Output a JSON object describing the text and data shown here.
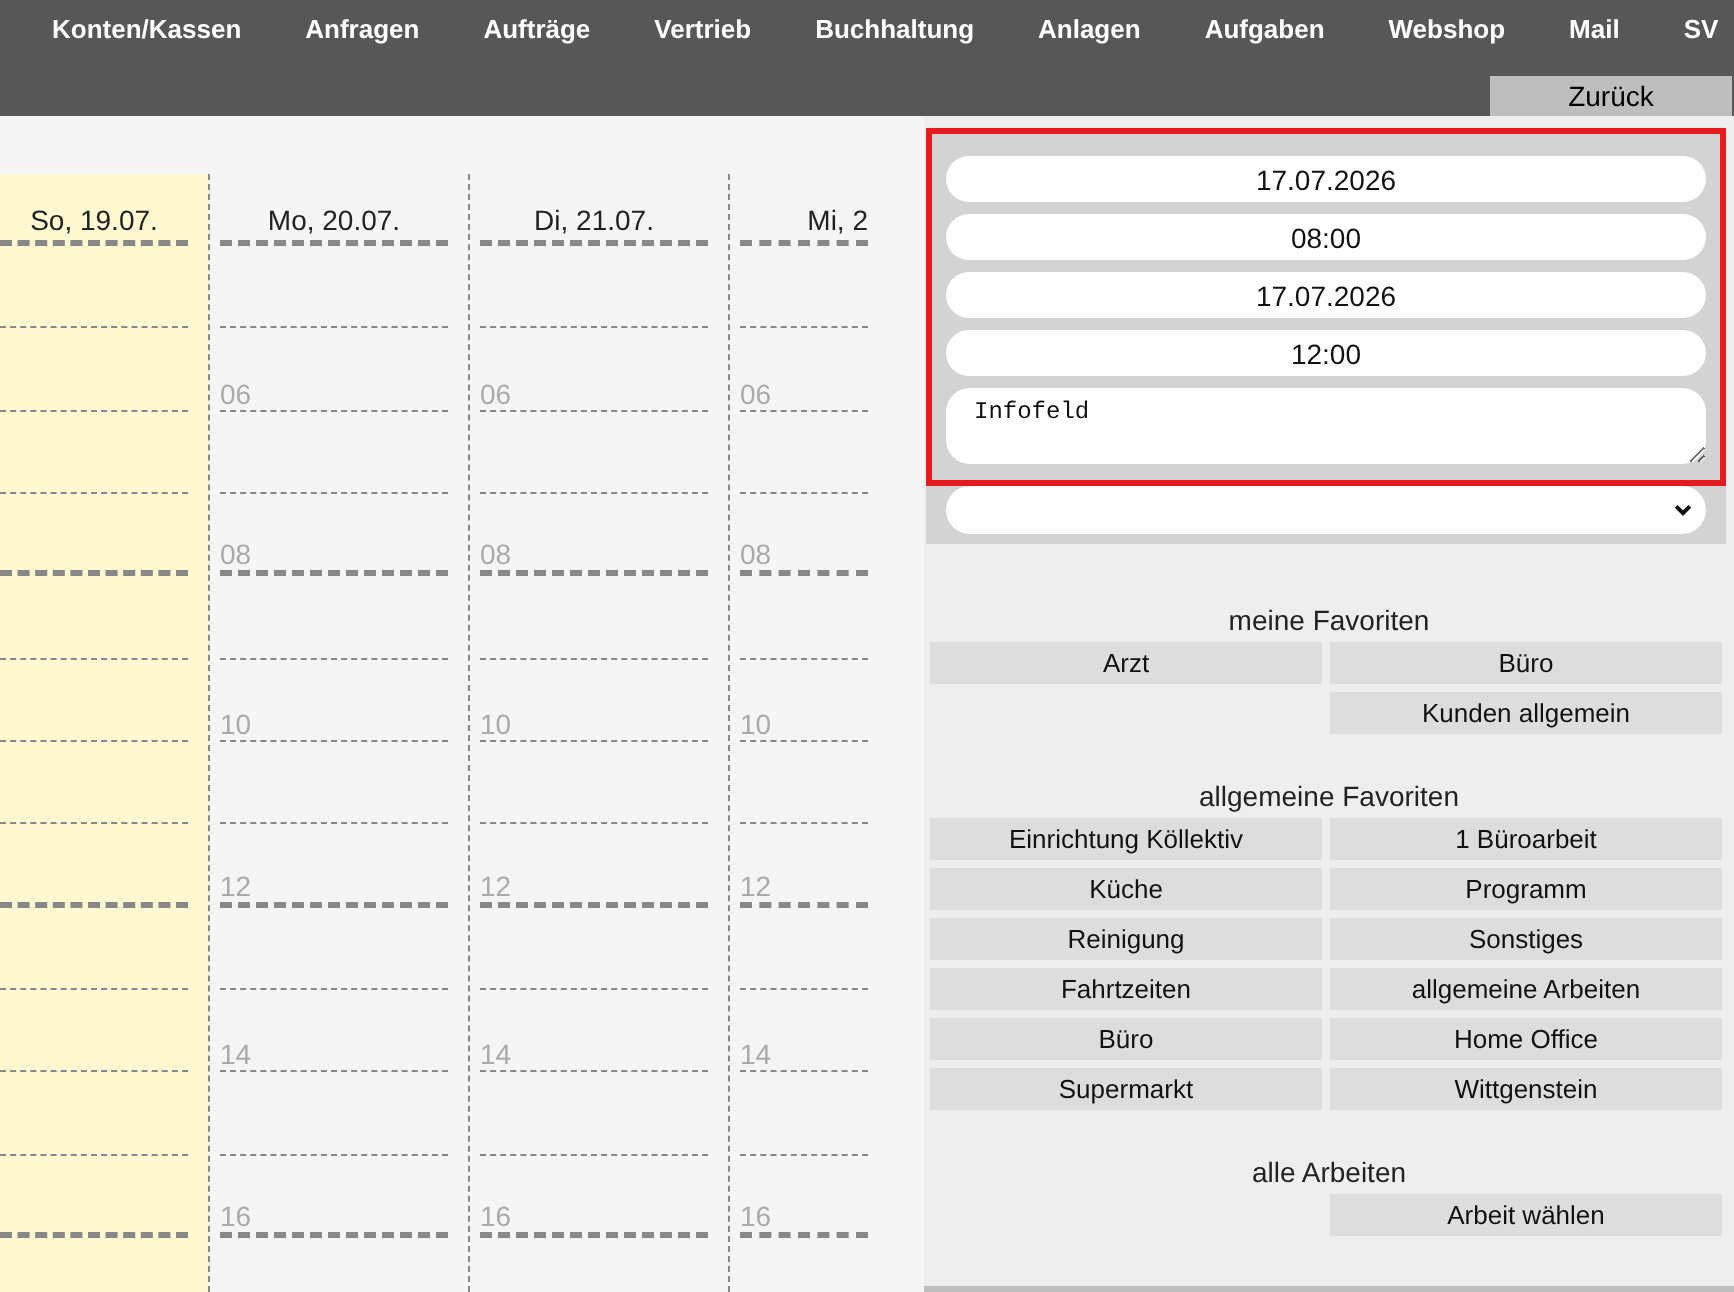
{
  "nav": {
    "items": [
      "Konten/Kassen",
      "Anfragen",
      "Aufträge",
      "Vertrieb",
      "Buchhaltung",
      "Anlagen",
      "Aufgaben",
      "Webshop",
      "Mail",
      "SV"
    ],
    "back_button": "Zurück"
  },
  "calendar": {
    "days": [
      {
        "label": "So, 19.07.",
        "highlighted": true
      },
      {
        "label": "Mo, 20.07.",
        "highlighted": false,
        "hour_labels": [
          "06",
          "08",
          "10",
          "12",
          "14",
          "16"
        ]
      },
      {
        "label": "Di, 21.07.",
        "highlighted": false,
        "hour_labels": [
          "06",
          "08",
          "10",
          "12",
          "14",
          "16"
        ]
      },
      {
        "label": "Mi, 2",
        "highlighted": false,
        "hour_labels": [
          "06",
          "08",
          "10",
          "12",
          "14",
          "16"
        ]
      }
    ]
  },
  "appointment_form": {
    "fields": [
      {
        "kind": "input",
        "value": "17.07.2026"
      },
      {
        "kind": "input",
        "value": "08:00"
      },
      {
        "kind": "input",
        "value": "17.07.2026"
      },
      {
        "kind": "input",
        "value": "12:00"
      },
      {
        "kind": "textarea",
        "value": "Infofeld"
      }
    ]
  },
  "favorite_sections": [
    {
      "title": "meine Favoriten",
      "rows": [
        {
          "left": "Arzt",
          "right": "Büro"
        },
        {
          "right": "Kunden allgemein"
        }
      ]
    },
    {
      "title": "allgemeine Favoriten",
      "rows": [
        {
          "left": "Einrichtung Köllektiv",
          "right": "1 Büroarbeit"
        },
        {
          "left": "Küche",
          "right": "Programm"
        },
        {
          "left": "Reinigung",
          "right": "Sonstiges"
        },
        {
          "left": "Fahrtzeiten",
          "right": "allgemeine Arbeiten"
        },
        {
          "left": "Büro",
          "right": "Home Office"
        },
        {
          "left": "Supermarkt",
          "right": "Wittgenstein"
        }
      ]
    },
    {
      "title": "alle Arbeiten",
      "rows": [
        {
          "right": "Arbeit wählen"
        }
      ]
    }
  ]
}
